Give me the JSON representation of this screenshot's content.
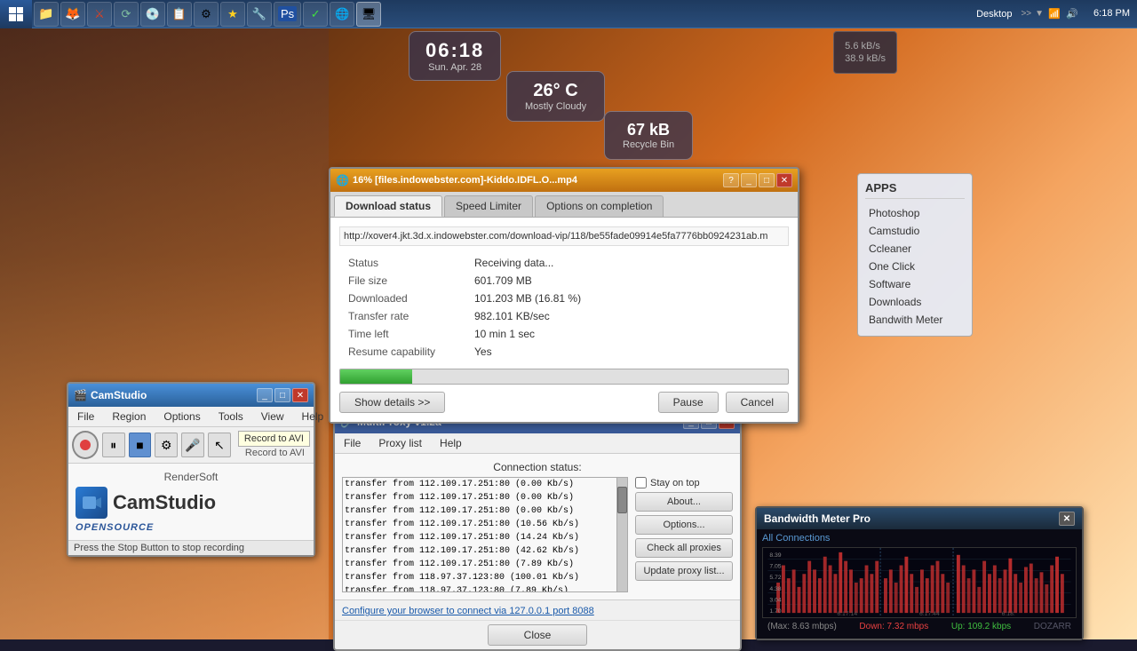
{
  "taskbar": {
    "start_label": "Desktop",
    "time": "6:18 PM",
    "apps": [
      {
        "name": "windows-icon",
        "label": "⊞"
      },
      {
        "name": "explorer-icon",
        "label": "📁"
      },
      {
        "name": "firefox-icon",
        "label": "🦊"
      },
      {
        "name": "antivirus-icon",
        "label": "🛡"
      },
      {
        "name": "update-icon",
        "label": "⟳"
      },
      {
        "name": "cd-icon",
        "label": "💿"
      },
      {
        "name": "clipboard-icon",
        "label": "📋"
      },
      {
        "name": "task-icon",
        "label": "⚙"
      },
      {
        "name": "checkmark-icon",
        "label": "✓"
      },
      {
        "name": "star-icon",
        "label": "★"
      },
      {
        "name": "tools-icon",
        "label": "🔧"
      },
      {
        "name": "globe-icon",
        "label": "🌐"
      },
      {
        "name": "ff-icon",
        "label": "⚡"
      },
      {
        "name": "monitor-icon",
        "label": "🖥"
      }
    ]
  },
  "clock_widget": {
    "time": "06:18",
    "date": "Sun.  Apr.  28"
  },
  "weather_widget": {
    "temp": "26° C",
    "condition": "Mostly Cloudy"
  },
  "recycle_bin": {
    "size": "67 kB",
    "label": "Recycle Bin"
  },
  "network_speed": {
    "download": "5.6 kB/s",
    "upload": "38.9 kB/s"
  },
  "apps_panel": {
    "title": "APPS",
    "items": [
      {
        "label": "Photoshop"
      },
      {
        "label": "Camstudio"
      },
      {
        "label": "Ccleaner"
      },
      {
        "label": "One Click"
      },
      {
        "label": "Software"
      },
      {
        "label": "Downloads"
      },
      {
        "label": "Bandwith Meter"
      }
    ]
  },
  "camstudio": {
    "title": "CamStudio",
    "menu": [
      "File",
      "Region",
      "Options",
      "Tools",
      "View",
      "Help"
    ],
    "record_tooltip": "Record to AVI",
    "brand": "RenderSoft",
    "app_name": "CamStudio",
    "badge": "OPENSOURCE",
    "status": "Press the Stop Button to stop recording"
  },
  "download_window": {
    "title": "16% [files.indowebster.com]-Kiddo.IDFL.O...mp4",
    "tabs": [
      "Download status",
      "Speed Limiter",
      "Options on completion"
    ],
    "active_tab": "Download status",
    "url": "http://xover4.jkt.3d.x.indowebster.com/download-vip/118/be55fade09914e5fa7776bb0924231ab.m",
    "fields": [
      {
        "label": "Status",
        "value": "Receiving data...",
        "status": true
      },
      {
        "label": "File size",
        "value": "601.709  MB"
      },
      {
        "label": "Downloaded",
        "value": "101.203  MB  (16.81 %)"
      },
      {
        "label": "Transfer rate",
        "value": "982.101  KB/sec"
      },
      {
        "label": "Time left",
        "value": "10 min 1 sec"
      },
      {
        "label": "Resume capability",
        "value": "Yes"
      }
    ],
    "progress": 16,
    "buttons": {
      "show_details": "Show details >>",
      "pause": "Pause",
      "cancel": "Cancel"
    }
  },
  "proxy_window": {
    "title": "MultiProxy v1.2a",
    "menu": [
      "File",
      "Proxy list",
      "Help"
    ],
    "connection_status_label": "Connection status:",
    "stay_on_top": "Stay on top",
    "log_lines": [
      "transfer from 112.109.17.251:80 (0.00 Kb/s)",
      "transfer from 112.109.17.251:80 (0.00 Kb/s)",
      "transfer from 112.109.17.251:80 (0.00 Kb/s)",
      "transfer from 112.109.17.251:80 (10.56 Kb/s)",
      "transfer from 112.109.17.251:80 (14.24 Kb/s)",
      "transfer from 112.109.17.251:80 (42.62 Kb/s)",
      "transfer from 112.109.17.251:80 (7.89 Kb/s)",
      "transfer from 118.97.37.123:80 (100.01 Kb/s)",
      "transfer from 118.97.37.123:80 (7.89 Kb/s)"
    ],
    "buttons": {
      "about": "About...",
      "options": "Options...",
      "check_all": "Check all proxies",
      "update": "Update proxy list...",
      "close": "Close"
    },
    "footer_link": "Configure your browser to connect via 127.0.0.1 port 8088"
  },
  "bandwidth_panel": {
    "title": "Bandwidth Meter Pro",
    "all_connections_label": "All Connections",
    "speed_labels": [
      "8.39 mbps",
      "7.05 mbps",
      "5.72 mbps",
      "4.38 mbps",
      "3.04 mbps",
      "1.70 mbps"
    ],
    "time_labels": [
      "6:17:14",
      "6:17:44",
      "6:18:"
    ],
    "down_label": "Down: 7.32 mbps",
    "up_label": "Up: 109.2 kbps",
    "max_label": "(Max: 8.63 mbps)",
    "brand": "DOZARR"
  }
}
